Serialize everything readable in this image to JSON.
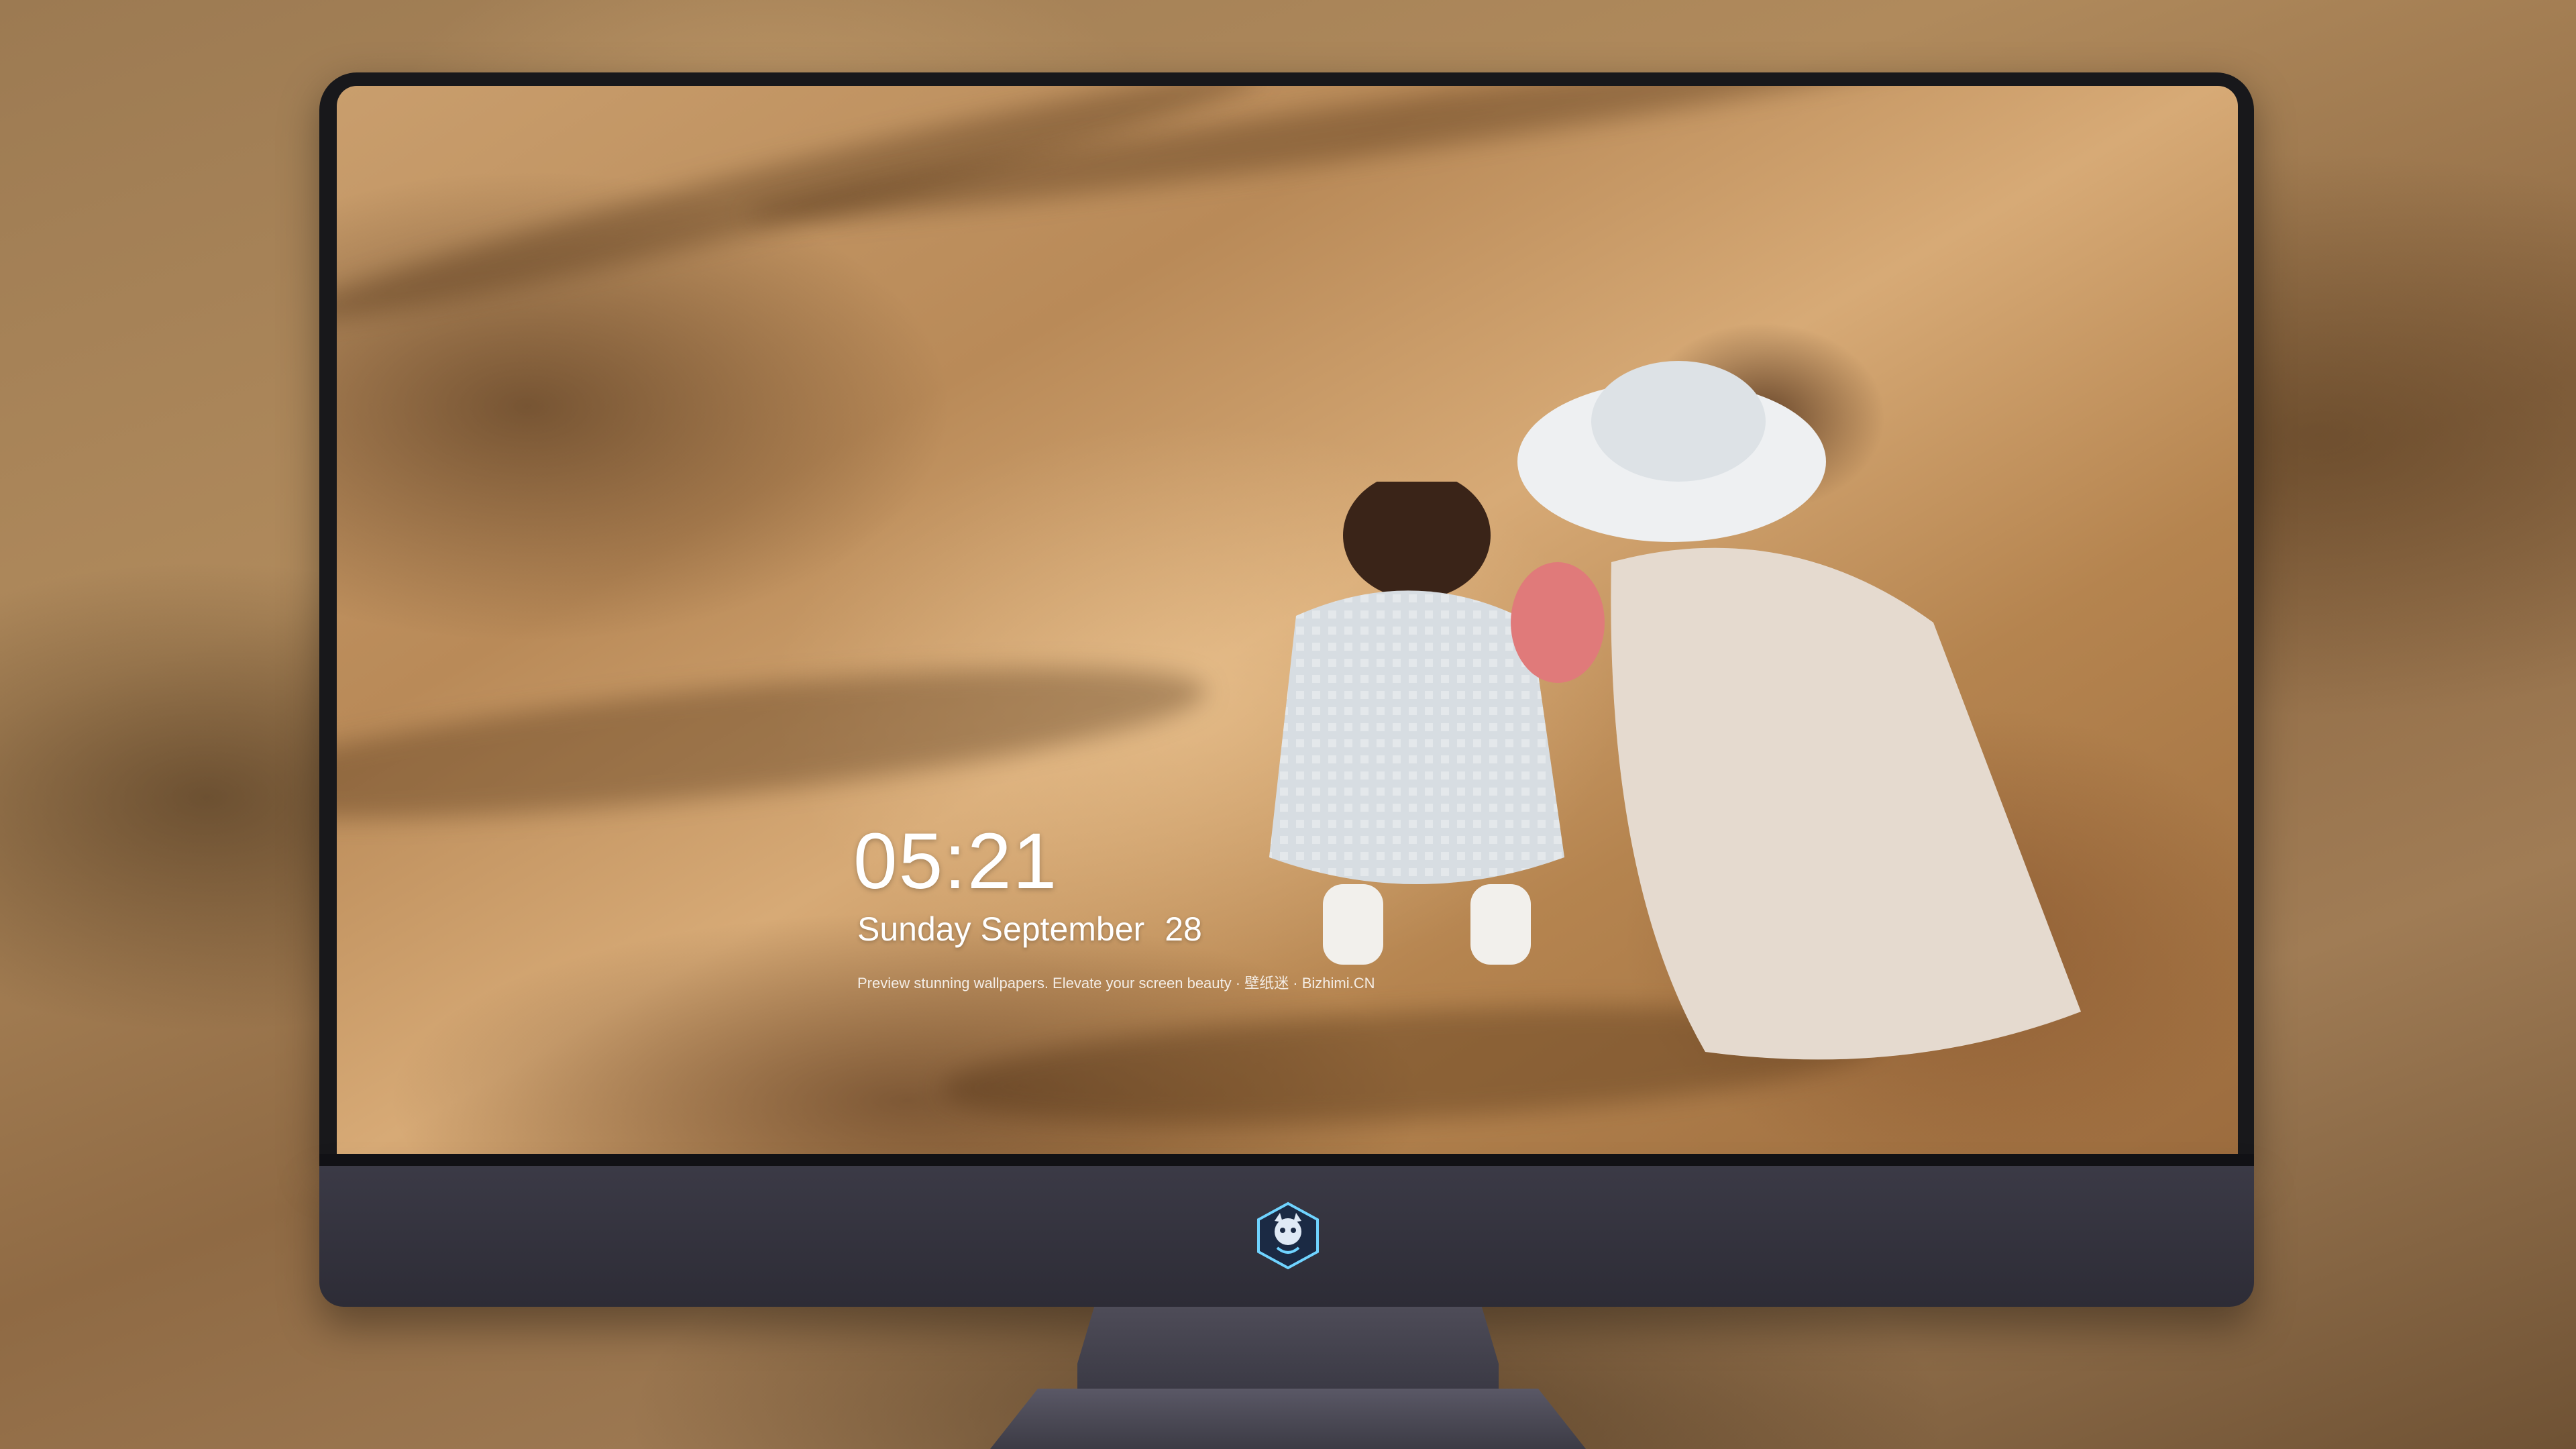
{
  "lock_screen": {
    "time": "05:21",
    "date": {
      "weekday": "Sunday",
      "month": "September",
      "day": "28"
    },
    "tagline": "Preview stunning wallpapers. Elevate your screen beauty · 壁纸迷 · Bizhimi.CN"
  },
  "dock": {
    "apps": [
      {
        "name": "messages-icon",
        "color": "#34c759"
      },
      {
        "name": "weather-icon",
        "color": "#1e88e5"
      },
      {
        "name": "clock-icon",
        "color": "#ffffff"
      },
      {
        "name": "preview-icon",
        "color": "#4a90e2"
      },
      {
        "name": "clips-icon",
        "color": "#00b4d8"
      },
      {
        "name": "notes-icon",
        "color": "#ffd60a"
      },
      {
        "name": "photo-gallery-icon",
        "color": "#f5f5f5"
      },
      {
        "name": "music-icon",
        "color": "#fa57c1"
      },
      {
        "name": "app-store-icon",
        "color": "#147efb"
      },
      {
        "name": "camera-icon",
        "color": "#8e8e93"
      }
    ]
  },
  "colors": {
    "bezel": "#18181b",
    "chin": "#2d2c36",
    "text": "#ffffff"
  }
}
